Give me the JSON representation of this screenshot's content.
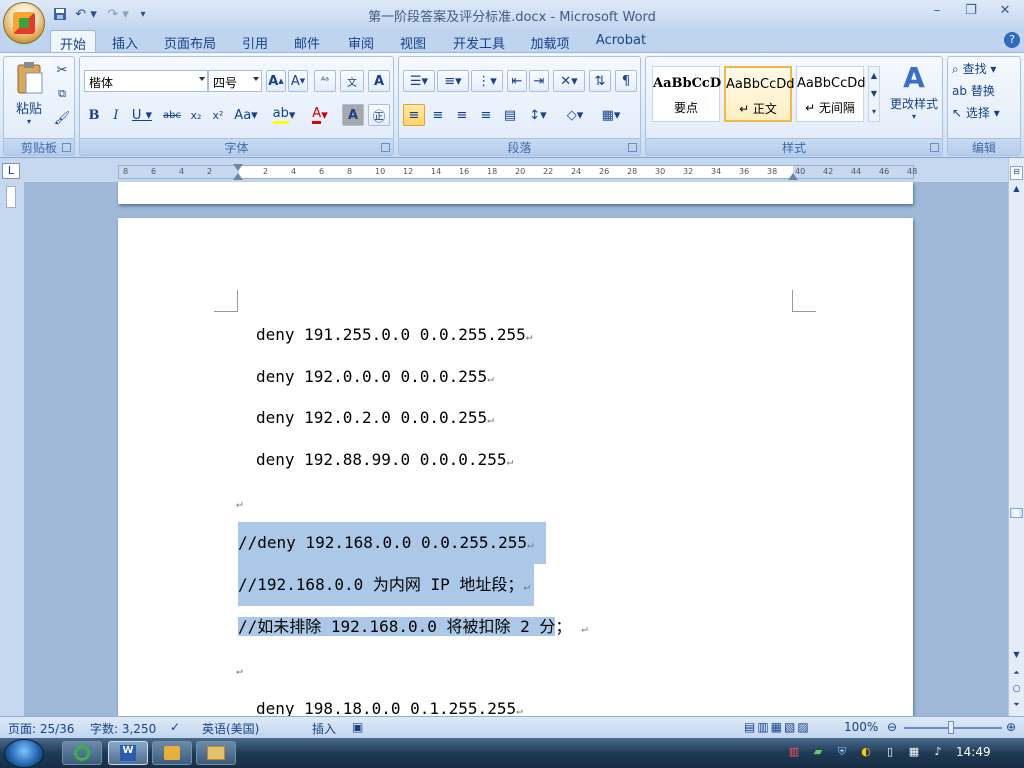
{
  "titlebar": {
    "title": "第一阶段答案及评分标准.docx - Microsoft Word",
    "qat_icons": [
      "save-icon",
      "undo-icon",
      "redo-icon",
      "customize-icon"
    ]
  },
  "tabs": [
    {
      "label": "开始",
      "active": true
    },
    {
      "label": "插入"
    },
    {
      "label": "页面布局"
    },
    {
      "label": "引用"
    },
    {
      "label": "邮件"
    },
    {
      "label": "审阅"
    },
    {
      "label": "视图"
    },
    {
      "label": "开发工具"
    },
    {
      "label": "加载项"
    },
    {
      "label": "Acrobat"
    }
  ],
  "ribbon": {
    "clipboard": {
      "paste_label": "粘贴",
      "group_label": "剪贴板"
    },
    "font": {
      "font_name": "楷体",
      "font_size": "四号",
      "group_label": "字体"
    },
    "paragraph": {
      "group_label": "段落"
    },
    "styles": {
      "group_label": "样式",
      "items": [
        {
          "sample": "AaBbCcD",
          "name": "要点"
        },
        {
          "sample": "AaBbCcDd",
          "name": "↵ 正文"
        },
        {
          "sample": "AaBbCcDd",
          "name": "↵ 无间隔"
        }
      ],
      "change_label": "更改样式"
    },
    "editing": {
      "group_label": "编辑",
      "find": "查找",
      "replace": "替换",
      "select": "选择"
    }
  },
  "ruler": {
    "ticks": [
      "8",
      "6",
      "4",
      "2",
      "",
      "2",
      "4",
      "6",
      "8",
      "10",
      "12",
      "14",
      "16",
      "18",
      "20",
      "22",
      "24",
      "26",
      "28",
      "30",
      "32",
      "34",
      "36",
      "38",
      "40",
      "42",
      "44",
      "46",
      "48"
    ]
  },
  "document": {
    "lines": [
      {
        "text": "deny 191.255.0.0 0.0.255.255",
        "highlight": false
      },
      {
        "text": "deny 192.0.0.0 0.0.0.255",
        "highlight": false
      },
      {
        "text": "deny 192.0.2.0 0.0.0.255",
        "highlight": false
      },
      {
        "text": "deny 192.88.99.0 0.0.0.255",
        "highlight": false
      },
      {
        "text": "",
        "highlight": false
      },
      {
        "text": "//deny 192.168.0.0 0.0.255.255",
        "highlight": true
      },
      {
        "text": "//192.168.0.0 为内网 IP 地址段；",
        "highlight": true
      },
      {
        "text": "//如未排除 192.168.0.0 将被扣除 2 分",
        "highlight": true,
        "tail": "；"
      },
      {
        "text": "",
        "highlight": false
      },
      {
        "text": "deny 198.18.0.0 0.1.255.255",
        "highlight": false
      }
    ],
    "para_mark": "↵"
  },
  "status": {
    "page": "页面: 25/36",
    "words": "字数: 3,250",
    "language": "英语(美国)",
    "mode": "插入",
    "zoom": "100%"
  },
  "taskbar": {
    "time": "14:49"
  }
}
